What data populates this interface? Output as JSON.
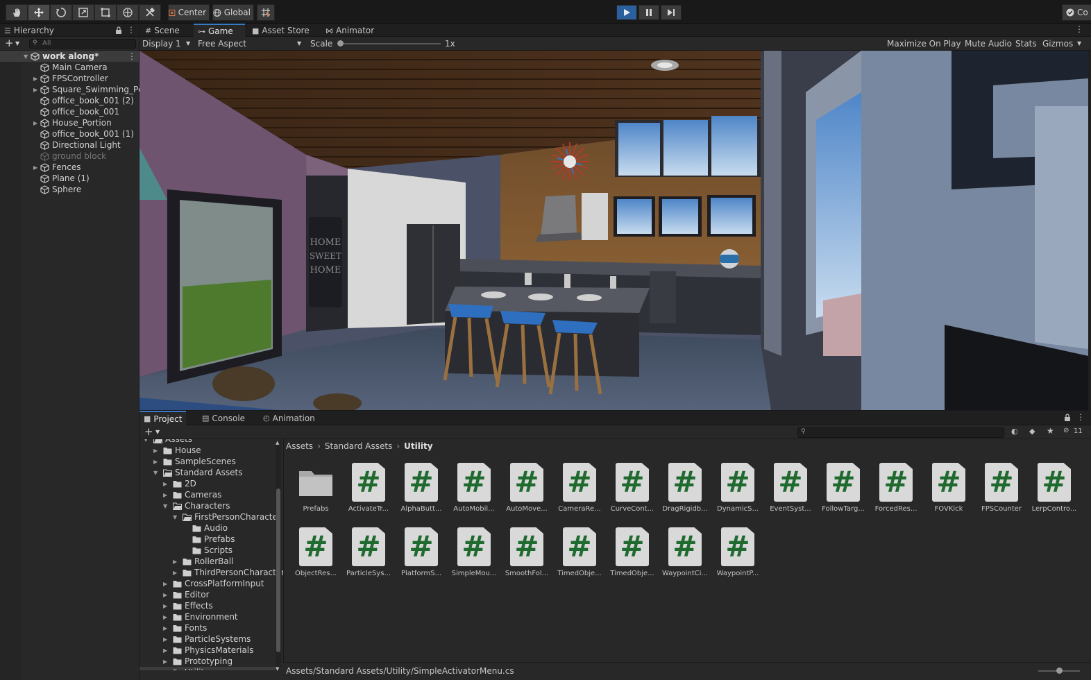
{
  "toolbar": {
    "pivot_center": "Center",
    "pivot_global": "Global",
    "right_label": "Co"
  },
  "hierarchy": {
    "tab": "Hierarchy",
    "search_placeholder": "All",
    "scene": "work along*",
    "items": [
      {
        "label": "Main Camera",
        "expandable": false,
        "dim": false
      },
      {
        "label": "FPSController",
        "expandable": true,
        "dim": false
      },
      {
        "label": "Square_Swimming_Pc",
        "expandable": true,
        "dim": false
      },
      {
        "label": "office_book_001 (2)",
        "expandable": false,
        "dim": false
      },
      {
        "label": "office_book_001",
        "expandable": false,
        "dim": false
      },
      {
        "label": "House_Portion",
        "expandable": true,
        "dim": false
      },
      {
        "label": "office_book_001 (1)",
        "expandable": false,
        "dim": false
      },
      {
        "label": "Directional Light",
        "expandable": false,
        "dim": false
      },
      {
        "label": "ground block",
        "expandable": false,
        "dim": true
      },
      {
        "label": "Fences",
        "expandable": true,
        "dim": false
      },
      {
        "label": "Plane (1)",
        "expandable": false,
        "dim": false
      },
      {
        "label": "Sphere",
        "expandable": false,
        "dim": false
      }
    ]
  },
  "main_tabs": {
    "scene": "Scene",
    "game": "Game",
    "asset_store": "Asset Store",
    "animator": "Animator"
  },
  "game_toolbar": {
    "display": "Display 1",
    "aspect": "Free Aspect",
    "scale_label": "Scale",
    "scale_value": "1x",
    "maximize": "Maximize On Play",
    "mute": "Mute Audio",
    "stats": "Stats",
    "gizmos": "Gizmos"
  },
  "bottom_tabs": {
    "project": "Project",
    "console": "Console",
    "animation": "Animation"
  },
  "project": {
    "hidden_count": "11",
    "tree": [
      {
        "label": "Assets",
        "depth": 0,
        "open": true
      },
      {
        "label": "House",
        "depth": 1,
        "open": false
      },
      {
        "label": "SampleScenes",
        "depth": 1,
        "open": false
      },
      {
        "label": "Standard Assets",
        "depth": 1,
        "open": true
      },
      {
        "label": "2D",
        "depth": 2,
        "open": false
      },
      {
        "label": "Cameras",
        "depth": 2,
        "open": false
      },
      {
        "label": "Characters",
        "depth": 2,
        "open": true
      },
      {
        "label": "FirstPersonCharacter",
        "depth": 3,
        "open": true
      },
      {
        "label": "Audio",
        "depth": 4,
        "open": false
      },
      {
        "label": "Prefabs",
        "depth": 4,
        "open": false
      },
      {
        "label": "Scripts",
        "depth": 4,
        "open": false
      },
      {
        "label": "RollerBall",
        "depth": 3,
        "open": false
      },
      {
        "label": "ThirdPersonCharacter",
        "depth": 3,
        "open": false
      },
      {
        "label": "CrossPlatformInput",
        "depth": 2,
        "open": false
      },
      {
        "label": "Editor",
        "depth": 2,
        "open": false
      },
      {
        "label": "Effects",
        "depth": 2,
        "open": false
      },
      {
        "label": "Environment",
        "depth": 2,
        "open": false
      },
      {
        "label": "Fonts",
        "depth": 2,
        "open": false
      },
      {
        "label": "ParticleSystems",
        "depth": 2,
        "open": false
      },
      {
        "label": "PhysicsMaterials",
        "depth": 2,
        "open": false
      },
      {
        "label": "Prototyping",
        "depth": 2,
        "open": false
      },
      {
        "label": "Utility",
        "depth": 2,
        "open": false
      }
    ],
    "breadcrumb": [
      "Assets",
      "Standard Assets",
      "Utility"
    ],
    "assets": [
      {
        "label": "Prefabs",
        "kind": "folder"
      },
      {
        "label": "ActivateTr...",
        "kind": "script"
      },
      {
        "label": "AlphaButt...",
        "kind": "script"
      },
      {
        "label": "AutoMobil...",
        "kind": "script"
      },
      {
        "label": "AutoMove...",
        "kind": "script"
      },
      {
        "label": "CameraRe...",
        "kind": "script"
      },
      {
        "label": "CurveCont...",
        "kind": "script"
      },
      {
        "label": "DragRigidb...",
        "kind": "script"
      },
      {
        "label": "DynamicS...",
        "kind": "script"
      },
      {
        "label": "EventSyst...",
        "kind": "script"
      },
      {
        "label": "FollowTarg...",
        "kind": "script"
      },
      {
        "label": "ForcedRes...",
        "kind": "script"
      },
      {
        "label": "FOVKick",
        "kind": "script"
      },
      {
        "label": "FPSCounter",
        "kind": "script"
      },
      {
        "label": "LerpContro...",
        "kind": "script"
      },
      {
        "label": "ObjectRes...",
        "kind": "script"
      },
      {
        "label": "ParticleSys...",
        "kind": "script"
      },
      {
        "label": "PlatformS...",
        "kind": "script"
      },
      {
        "label": "SimpleMou...",
        "kind": "script"
      },
      {
        "label": "SmoothFol...",
        "kind": "script"
      },
      {
        "label": "TimedObje...",
        "kind": "script"
      },
      {
        "label": "TimedObje...",
        "kind": "script"
      },
      {
        "label": "WaypointCi...",
        "kind": "script"
      },
      {
        "label": "WaypointP...",
        "kind": "script"
      }
    ],
    "status_path": "Assets/Standard Assets/Utility/SimpleActivatorMenu.cs"
  },
  "scene_art": {
    "sign_text": [
      "HOME",
      "SWEET",
      "HOME"
    ]
  }
}
